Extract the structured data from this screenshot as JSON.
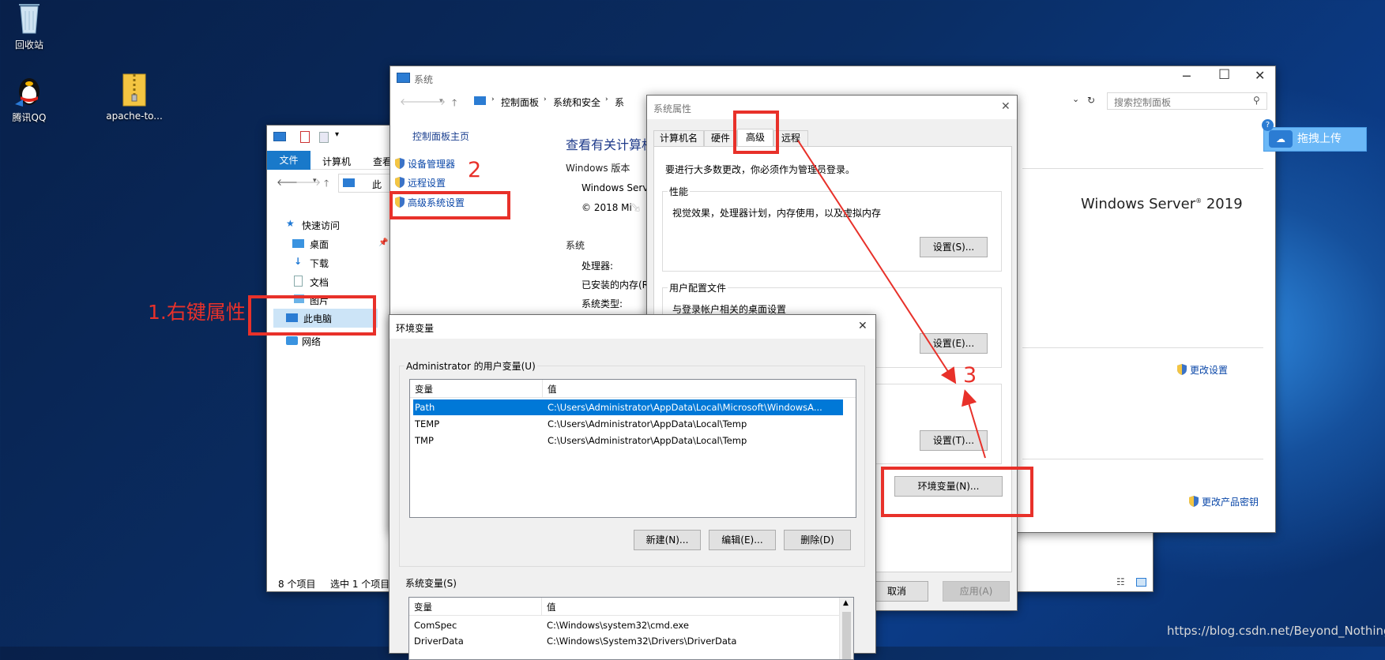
{
  "desktop": {
    "icons": [
      {
        "label": "回收站",
        "icon": "recycle-bin-icon"
      },
      {
        "label": "腾讯QQ",
        "icon": "qq-penguin-icon"
      },
      {
        "label": "apache-to...",
        "icon": "zip-folder-icon"
      }
    ]
  },
  "explorer": {
    "ribbon_tabs": [
      "文件",
      "计算机",
      "查看"
    ],
    "address_fragment": "此",
    "nav": {
      "quick_access": "快速访问",
      "desktop": "桌面",
      "downloads": "下载",
      "documents": "文档",
      "pictures": "图片",
      "this_pc": "此电脑",
      "network": "网络"
    },
    "status": {
      "count": "8 个项目",
      "selected": "选中 1 个项目"
    }
  },
  "system_window": {
    "title": "系统",
    "breadcrumb": [
      "控制面板",
      "系统和安全",
      "系"
    ],
    "search_placeholder": "搜索控制面板",
    "left_links": {
      "home": "控制面板主页",
      "device_manager": "设备管理器",
      "remote": "远程设置",
      "advanced": "高级系统设置"
    },
    "heading": "查看有关计算机",
    "win_edition_label": "Windows 版本",
    "win_edition": "Windows Serv",
    "copyright": "© 2018 Mi",
    "system_label": "系统",
    "processor_label": "处理器:",
    "ram_label": "已安装的内存(R",
    "type_label": "系统类型:",
    "os_logo": "Windows Server",
    "os_logo_sup": "®",
    "os_logo_year": " 2019",
    "change_settings": "更改设置",
    "change_key": "更改产品密钥"
  },
  "upload_button": "拖拽上传",
  "sysprops": {
    "title": "系统属性",
    "tabs": [
      "计算机名",
      "硬件",
      "高级",
      "远程"
    ],
    "admin_note": "要进行大多数更改，你必须作为管理员登录。",
    "perf": {
      "label": "性能",
      "desc": "视觉效果，处理器计划，内存使用，以及虚拟内存",
      "button": "设置(S)..."
    },
    "profile": {
      "label": "用户配置文件",
      "desc": "与登录帐户相关的桌面设置",
      "button": "设置(E)..."
    },
    "startup": {
      "button": "设置(T)..."
    },
    "env_button": "环境变量(N)...",
    "cancel": "取消",
    "apply": "应用(A)"
  },
  "envvars": {
    "title": "环境变量",
    "user_label": "Administrator 的用户变量(U)",
    "col_var": "变量",
    "col_val": "值",
    "user_rows": [
      {
        "name": "Path",
        "value": "C:\\Users\\Administrator\\AppData\\Local\\Microsoft\\WindowsA..."
      },
      {
        "name": "TEMP",
        "value": "C:\\Users\\Administrator\\AppData\\Local\\Temp"
      },
      {
        "name": "TMP",
        "value": "C:\\Users\\Administrator\\AppData\\Local\\Temp"
      }
    ],
    "new_btn": "新建(N)...",
    "edit_btn": "编辑(E)...",
    "delete_btn": "删除(D)",
    "sys_label": "系统变量(S)",
    "sys_rows": [
      {
        "name": "ComSpec",
        "value": "C:\\Windows\\system32\\cmd.exe"
      },
      {
        "name": "DriverData",
        "value": "C:\\Windows\\System32\\Drivers\\DriverData"
      }
    ]
  },
  "annotations": {
    "step1": "1.右键属性",
    "step2": "2",
    "step3": "3",
    "color": "#e8312a"
  },
  "watermark": "https://blog.csdn.net/Beyond_Nothing"
}
